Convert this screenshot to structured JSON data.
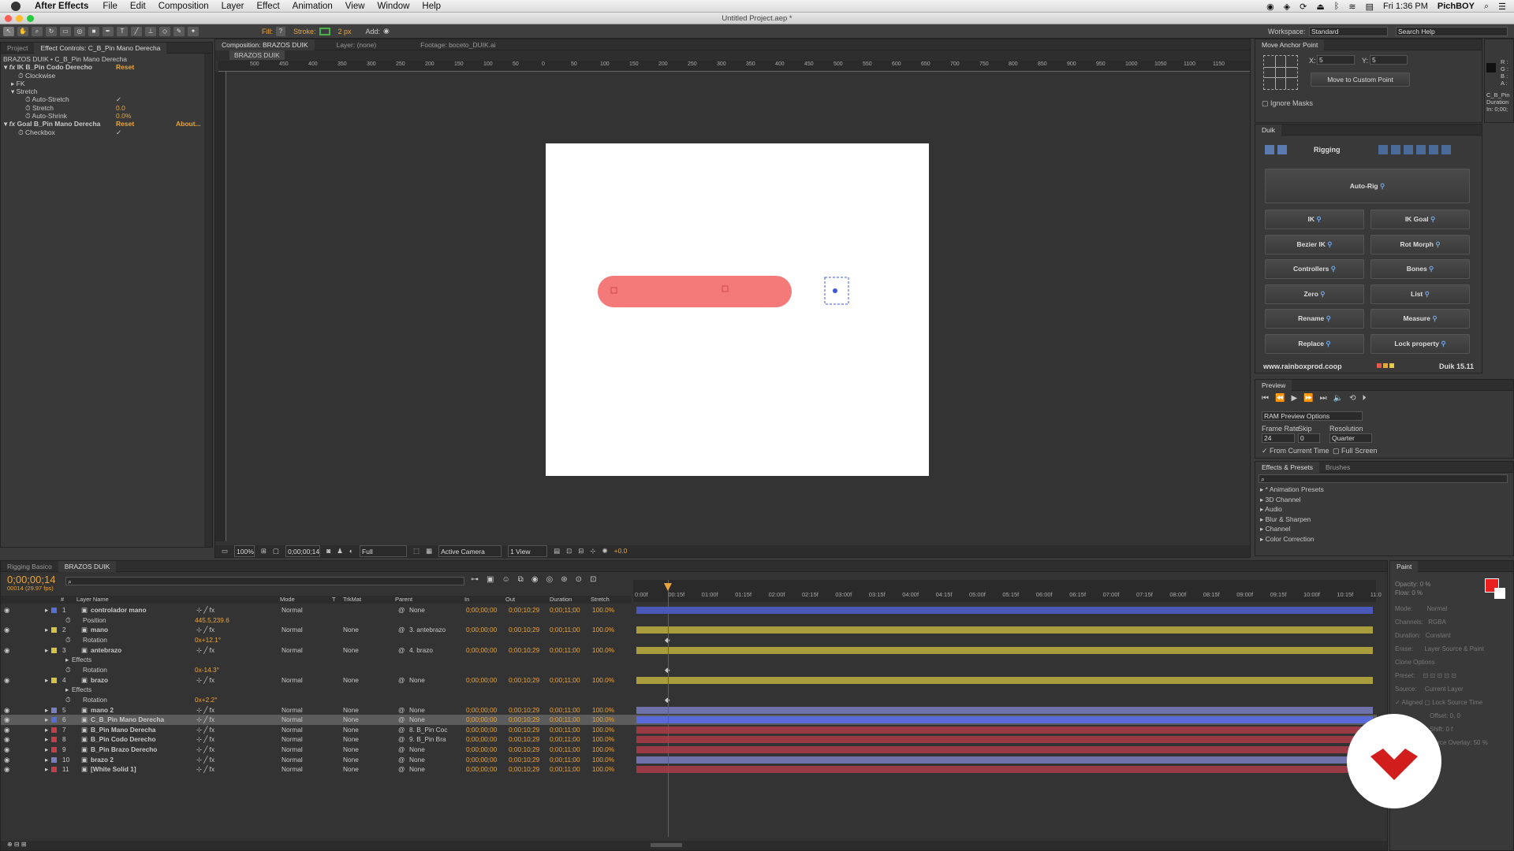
{
  "menu": {
    "app_name": "After Effects",
    "items": [
      "File",
      "Edit",
      "Composition",
      "Layer",
      "Effect",
      "Animation",
      "View",
      "Window",
      "Help"
    ],
    "clock": "Fri 1:36 PM",
    "user": "PichBOY"
  },
  "window_title": "Untitled Project.aep *",
  "toolbar": {
    "fill_label": "Fill:",
    "stroke_label": "Stroke:",
    "stroke_width": "2 px",
    "add_label": "Add:",
    "workspace_label": "Workspace:",
    "workspace_value": "Standard",
    "search_help": "Search Help"
  },
  "effect_controls": {
    "tab_project": "Project",
    "tab_effects": "Effect Controls: C_B_Pin Mano Derecha",
    "breadcrumb": "BRAZOS DUIK • C_B_Pin Mano Derecha",
    "rows": [
      {
        "label": "IK B_Pin Codo Derecho",
        "value": "Reset",
        "indent": 0,
        "fx": true
      },
      {
        "label": "Clockwise",
        "value": "",
        "indent": 2,
        "fx": false
      },
      {
        "label": "FK",
        "value": "",
        "indent": 1,
        "fx": false
      },
      {
        "label": "Stretch",
        "value": "",
        "indent": 1,
        "fx": false
      },
      {
        "label": "Auto-Stretch",
        "value": "✓",
        "indent": 3,
        "fx": false
      },
      {
        "label": "Stretch",
        "value": "0.0",
        "indent": 3,
        "fx": false
      },
      {
        "label": "Auto-Shrink",
        "value": "0.0%",
        "indent": 3,
        "fx": false
      },
      {
        "label": "Goal B_Pin Mano Derecha",
        "value": "Reset",
        "indent": 0,
        "fx": true,
        "extra": "About..."
      },
      {
        "label": "Checkbox",
        "value": "✓",
        "indent": 2,
        "fx": false
      }
    ]
  },
  "composition": {
    "tab_comp": "Composition: BRAZOS DUIK",
    "tab_layer": "Layer: (none)",
    "tab_footage": "Footage: boceto_DUIK.ai",
    "comp_name": "BRAZOS DUIK",
    "ruler_labels": [
      "500",
      "450",
      "400",
      "350",
      "300",
      "250",
      "200",
      "150",
      "100",
      "50",
      "0",
      "50",
      "100",
      "150",
      "200",
      "250",
      "300",
      "350",
      "400",
      "450",
      "500",
      "550",
      "600",
      "650",
      "700",
      "750",
      "800",
      "850",
      "900",
      "950",
      "1000",
      "1050",
      "1100",
      "1150"
    ],
    "zoom": "100%",
    "timecode": "0;00;00;14",
    "resolution": "Full",
    "camera": "Active Camera",
    "view": "1 View",
    "exposure": "+0.0"
  },
  "anchor_panel": {
    "title": "Move Anchor Point",
    "x_label": "X:",
    "x_value": "5",
    "y_label": "Y:",
    "y_value": "5",
    "button": "Move to Custom Point",
    "ignore_masks": "Ignore Masks"
  },
  "info_panel": {
    "rgb": [
      "R :",
      "G :",
      "B :",
      "A :"
    ],
    "lines": [
      "C_B_Pin",
      "Duration",
      "In: 0;00;"
    ]
  },
  "duik": {
    "tab": "Duik",
    "section": "Rigging",
    "auto_rig": "Auto-Rig",
    "buttons": [
      [
        "IK",
        "IK Goal"
      ],
      [
        "Bezier IK",
        "Rot Morph"
      ],
      [
        "Controllers",
        "Bones"
      ],
      [
        "Zero",
        "List"
      ],
      [
        "Rename",
        "Measure"
      ],
      [
        "Replace",
        "Lock property"
      ]
    ],
    "website": "www.rainboxprod.coop",
    "version": "Duik 15.11"
  },
  "preview": {
    "tab": "Preview",
    "options": "RAM Preview Options",
    "frame_rate_label": "Frame Rate",
    "skip_label": "Skip",
    "resolution_label": "Resolution",
    "frame_rate": "24",
    "skip": "0",
    "resolution": "Quarter",
    "from_current": "From Current Time",
    "full_screen": "Full Screen"
  },
  "effects_presets": {
    "tab1": "Effects & Presets",
    "tab2": "Brushes",
    "items": [
      "* Animation Presets",
      "3D Channel",
      "Audio",
      "Blur & Sharpen",
      "Channel",
      "Color Correction"
    ]
  },
  "timeline": {
    "tab1": "Rigging Basico",
    "tab2": "BRAZOS DUIK",
    "timecode": "0;00;00;14",
    "fps": "00014 (29.97 fps)",
    "headers": {
      "num": "#",
      "name": "Layer Name",
      "mode": "Mode",
      "t": "T",
      "trkmat": "TrkMat",
      "parent": "Parent",
      "in": "In",
      "out": "Out",
      "duration": "Duration",
      "stretch": "Stretch"
    },
    "ruler": [
      "0:00f",
      "00:15f",
      "01:00f",
      "01:15f",
      "02:00f",
      "02:15f",
      "03:00f",
      "03:15f",
      "04:00f",
      "04:15f",
      "05:00f",
      "05:15f",
      "06:00f",
      "06:15f",
      "07:00f",
      "07:15f",
      "08:00f",
      "08:15f",
      "09:00f",
      "09:15f",
      "10:00f",
      "10:15f",
      "11:0"
    ],
    "rows": [
      {
        "type": "layer",
        "num": "1",
        "name": "controlador mano",
        "color": "#5b6fd0",
        "mode": "Normal",
        "trk": "",
        "parent": "None",
        "in": "0;00;00;00",
        "out": "0;00;10;29",
        "dur": "0;00;11;00",
        "str": "100.0%",
        "bar": "#4a58b8"
      },
      {
        "type": "prop",
        "name": "Position",
        "value": "445.5,239.6"
      },
      {
        "type": "layer",
        "num": "2",
        "name": "mano",
        "color": "#d4c24a",
        "mode": "Normal",
        "trk": "None",
        "parent": "3. antebrazo",
        "in": "0;00;00;00",
        "out": "0;00;10;29",
        "dur": "0;00;11;00",
        "str": "100.0%",
        "bar": "#a89c3c"
      },
      {
        "type": "prop",
        "name": "Rotation",
        "value": "0x+12.1°"
      },
      {
        "type": "layer",
        "num": "3",
        "name": "antebrazo",
        "color": "#d4c24a",
        "mode": "Normal",
        "trk": "None",
        "parent": "4. brazo",
        "in": "0;00;00;00",
        "out": "0;00;10;29",
        "dur": "0;00;11;00",
        "str": "100.0%",
        "bar": "#a89c3c"
      },
      {
        "type": "prop",
        "name": "Effects",
        "value": ""
      },
      {
        "type": "prop",
        "name": "Rotation",
        "value": "0x-14.3°"
      },
      {
        "type": "layer",
        "num": "4",
        "name": "brazo",
        "color": "#d4c24a",
        "mode": "Normal",
        "trk": "None",
        "parent": "None",
        "in": "0;00;00;00",
        "out": "0;00;10;29",
        "dur": "0;00;11;00",
        "str": "100.0%",
        "bar": "#a89c3c"
      },
      {
        "type": "prop",
        "name": "Effects",
        "value": ""
      },
      {
        "type": "prop",
        "name": "Rotation",
        "value": "0x+2.2°"
      },
      {
        "type": "layer",
        "num": "5",
        "name": "mano 2",
        "color": "#7a7fc0",
        "mode": "Normal",
        "trk": "None",
        "parent": "None",
        "in": "0;00;00;00",
        "out": "0;00;10;29",
        "dur": "0;00;11;00",
        "str": "100.0%",
        "bar": "#6f72a8"
      },
      {
        "type": "layer",
        "num": "6",
        "name": "C_B_Pin Mano Derecha",
        "color": "#5b6fd0",
        "mode": "Normal",
        "trk": "None",
        "parent": "None",
        "in": "0;00;00;00",
        "out": "0;00;10;29",
        "dur": "0;00;11;00",
        "str": "100.0%",
        "bar": "#5a6ad8",
        "selected": true
      },
      {
        "type": "layer",
        "num": "7",
        "name": "B_Pin Mano Derecha",
        "color": "#c0404a",
        "mode": "Normal",
        "trk": "None",
        "parent": "8. B_Pin Coc",
        "in": "0;00;00;00",
        "out": "0;00;10;29",
        "dur": "0;00;11;00",
        "str": "100.0%",
        "bar": "#9a3a44"
      },
      {
        "type": "layer",
        "num": "8",
        "name": "B_Pin Codo Derecho",
        "color": "#c0404a",
        "mode": "Normal",
        "trk": "None",
        "parent": "9. B_Pin Bra",
        "in": "0;00;00;00",
        "out": "0;00;10;29",
        "dur": "0;00;11;00",
        "str": "100.0%",
        "bar": "#9a3a44"
      },
      {
        "type": "layer",
        "num": "9",
        "name": "B_Pin Brazo Derecho",
        "color": "#c0404a",
        "mode": "Normal",
        "trk": "None",
        "parent": "None",
        "in": "0;00;00;00",
        "out": "0;00;10;29",
        "dur": "0;00;11;00",
        "str": "100.0%",
        "bar": "#9a3a44"
      },
      {
        "type": "layer",
        "num": "10",
        "name": "brazo 2",
        "color": "#7a7fc0",
        "mode": "Normal",
        "trk": "None",
        "parent": "None",
        "in": "0;00;00;00",
        "out": "0;00;10;29",
        "dur": "0;00;11;00",
        "str": "100.0%",
        "bar": "#6f72a8"
      },
      {
        "type": "layer",
        "num": "11",
        "name": "[White Solid 1]",
        "color": "#c0404a",
        "mode": "Normal",
        "trk": "None",
        "parent": "None",
        "in": "0;00;00;00",
        "out": "0;00;10;29",
        "dur": "0;00;11;00",
        "str": "100.0%",
        "bar": "#9a3a44"
      }
    ]
  },
  "paint": {
    "tab": "Paint",
    "opacity": "Opacity: 0 %",
    "flow": "Flow: 0 %",
    "mode_label": "Mode:",
    "mode": "Normal",
    "channels_label": "Channels:",
    "channels": "RGBA",
    "duration_label": "Duration:",
    "duration": "Constant",
    "erase_label": "Erase:",
    "erase": "Layer Source & Paint",
    "clone_options": "Clone Options",
    "preset_label": "Preset:",
    "source_label": "Source:",
    "source": "Current Layer",
    "aligned": "Aligned",
    "lock_source": "Lock Source Time",
    "offset": "Offset: 0, 0",
    "shift": "Shift: 0 f",
    "source_overlay": "Source Overlay: 50 %"
  },
  "colors": {
    "accent": "#e8a53c",
    "stroke_green": "#4ab04a",
    "arm": "#f47a7a",
    "logo": "#d21d1d"
  }
}
